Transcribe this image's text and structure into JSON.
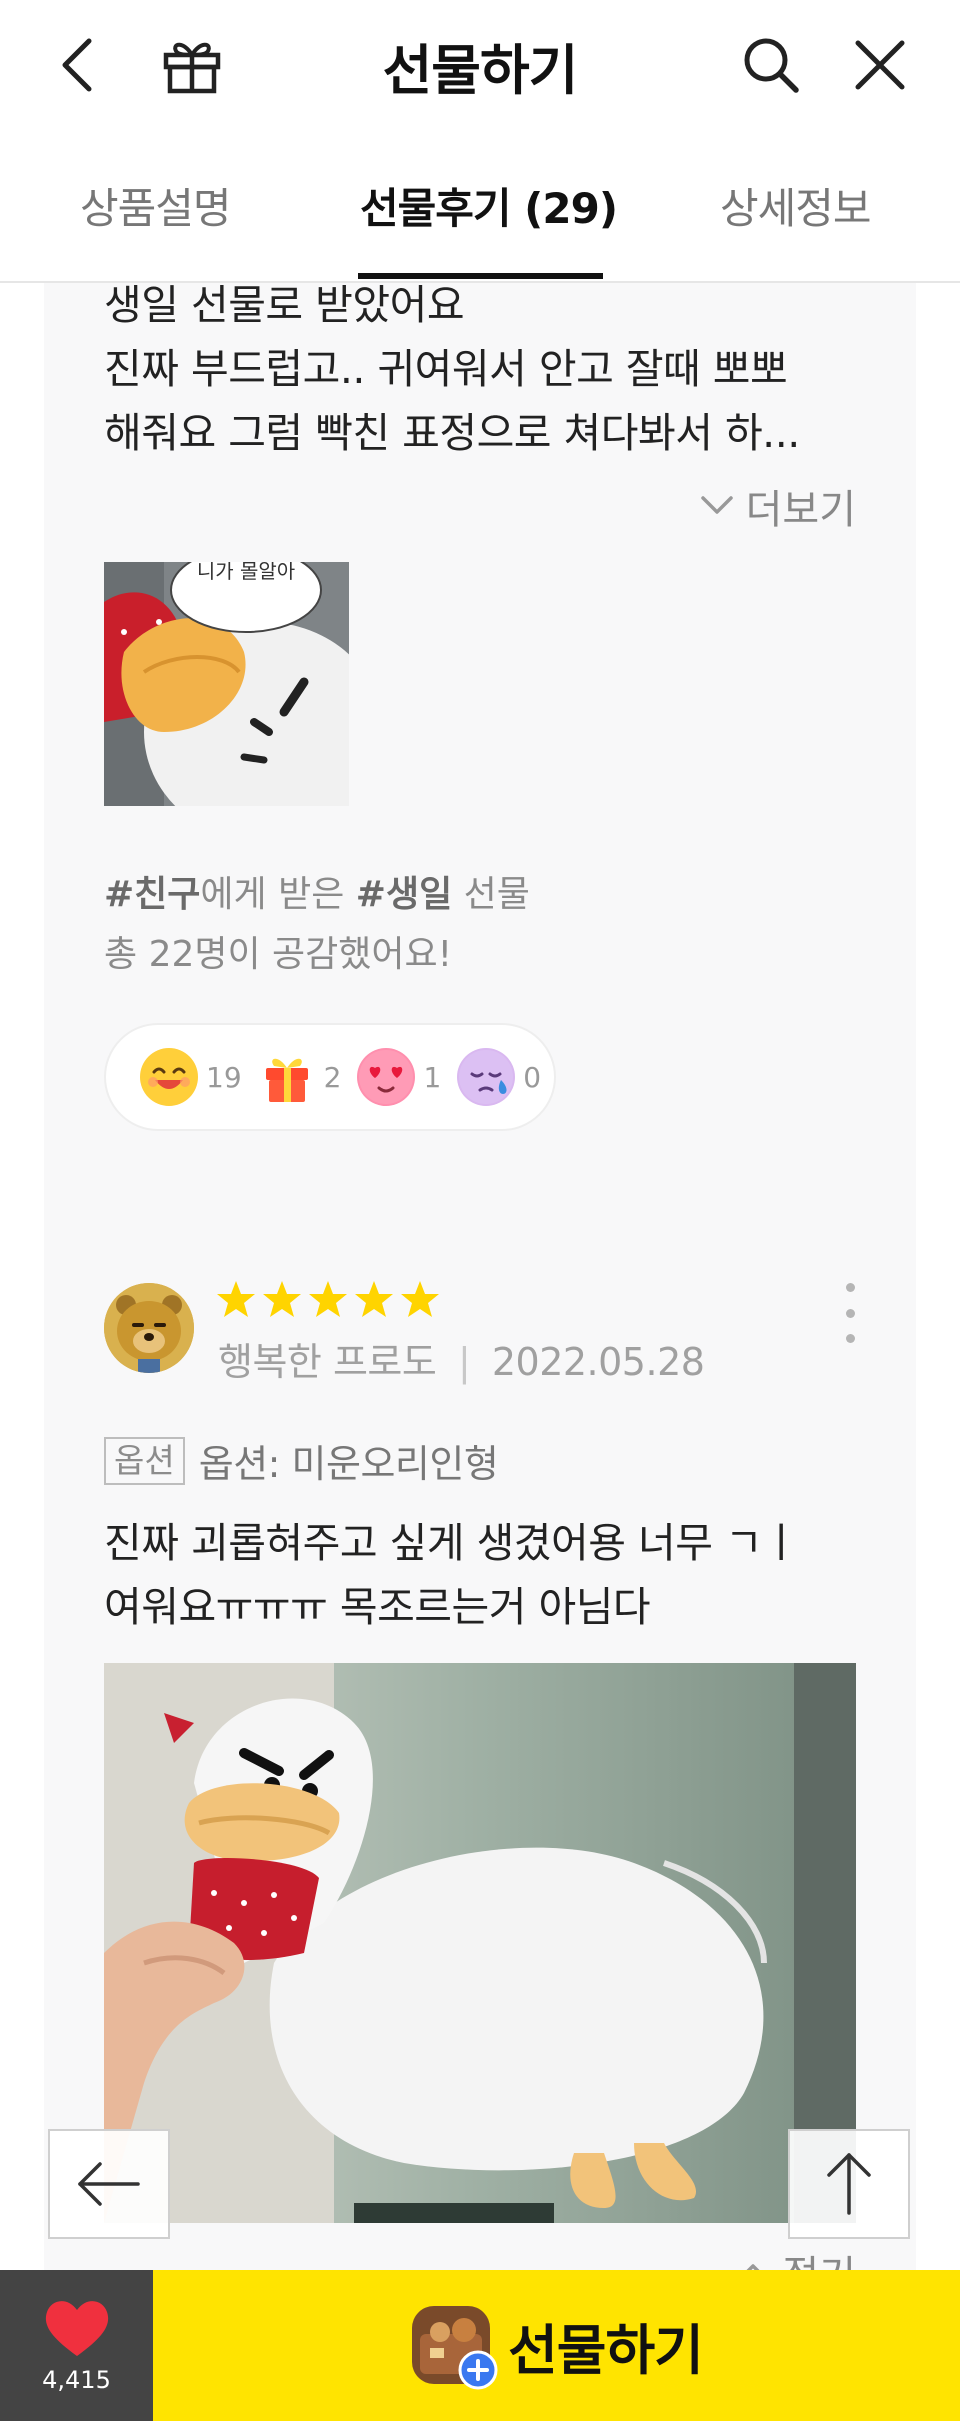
{
  "header": {
    "title": "선물하기",
    "back_icon": "chevron-left-icon",
    "gift_icon": "gift-box-icon",
    "search_icon": "search-icon",
    "close_icon": "close-icon"
  },
  "tabs": [
    {
      "label": "상품설명",
      "active": false
    },
    {
      "label": "선물후기 (29)",
      "active": true
    },
    {
      "label": "상세정보",
      "active": false
    }
  ],
  "review1": {
    "lines": [
      "생일 선물로 받았어요",
      "진짜 부드럽고.. 귀여워서 안고 잘때 뽀뽀",
      "해줘요 그럼 빡친 표정으로 쳐다봐서 하..."
    ],
    "more_label": "더보기",
    "bubble_text": "니가 몰알아",
    "tag_friend": "#친구",
    "tag_mid": "에게 받은 ",
    "tag_birthday": "#생일",
    "tag_end": " 선물",
    "empathy": "총 22명이 공감했어요!",
    "reactions": [
      {
        "icon": "laughing-emoji-icon",
        "count": "19"
      },
      {
        "icon": "gift-emoji-icon",
        "count": "2"
      },
      {
        "icon": "heart-eyes-emoji-icon",
        "count": "1"
      },
      {
        "icon": "sad-tear-emoji-icon",
        "count": "0"
      }
    ]
  },
  "review2": {
    "rating": 5,
    "author": "행복한 프로도",
    "separator": "|",
    "date": "2022.05.28",
    "option_badge": "옵션",
    "option_text": "옵션: 미운오리인형",
    "lines": [
      "진짜 괴롭혀주고 싶게 생겼어용 너무 ㄱㅣ",
      "여워요ㅠㅠㅠ 목조르는거 아님다"
    ],
    "fold_label": "접기"
  },
  "floating": {
    "back_icon": "arrow-left-icon",
    "top_icon": "arrow-up-icon"
  },
  "bottom": {
    "wish_count": "4,415",
    "gift_label": "선물하기"
  },
  "colors": {
    "accent_yellow": "#ffe400",
    "heart_red": "#f0303e",
    "star_yellow": "#ffd400",
    "dark_bar": "#444444"
  }
}
